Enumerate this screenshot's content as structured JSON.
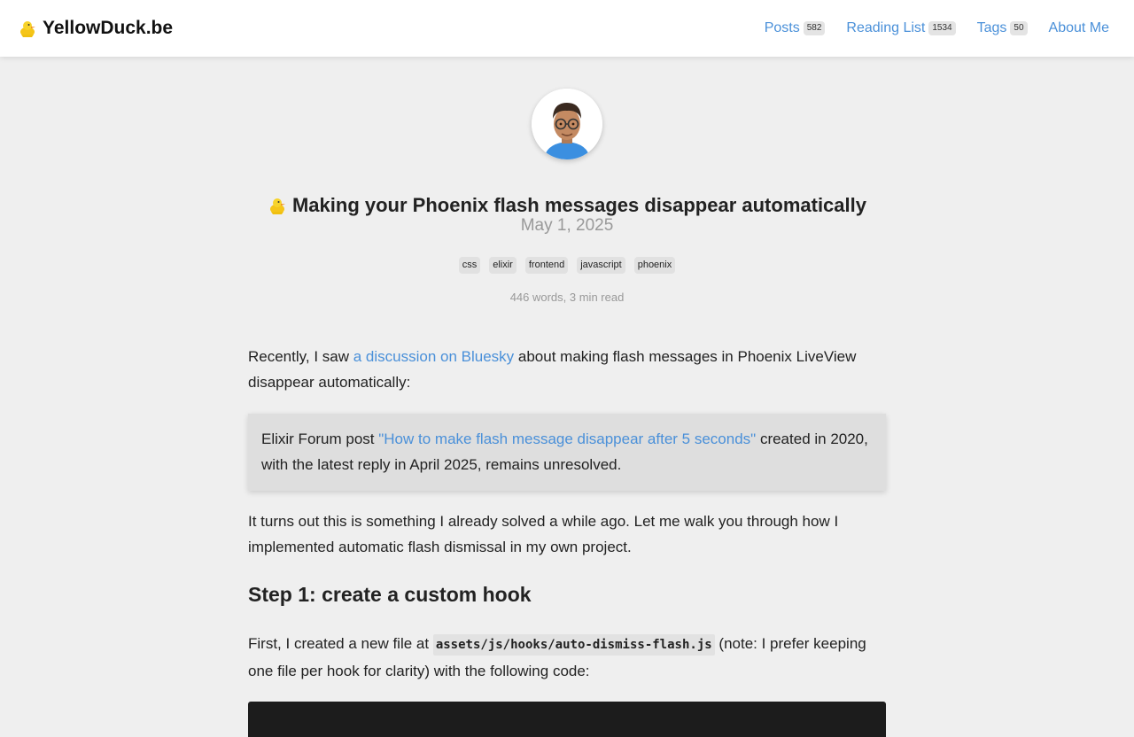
{
  "header": {
    "brand": "YellowDuck.be",
    "nav": [
      {
        "label": "Posts",
        "count": "582"
      },
      {
        "label": "Reading List",
        "count": "1534"
      },
      {
        "label": "Tags",
        "count": "50"
      },
      {
        "label": "About Me",
        "count": ""
      }
    ]
  },
  "post": {
    "title": "Making your Phoenix flash messages disappear automatically",
    "date": "May 1, 2025",
    "tags": [
      "css",
      "elixir",
      "frontend",
      "javascript",
      "phoenix"
    ],
    "meta": "446 words, 3 min read"
  },
  "content": {
    "p1_before": "Recently, I saw ",
    "p1_link": "a discussion on Bluesky",
    "p1_after": " about making flash messages in Phoenix LiveView disappear automatically:",
    "quote_before": "Elixir Forum post ",
    "quote_link": "\"How to make flash message disappear after 5 seconds\"",
    "quote_after": " created in 2020, with the latest reply in April 2025, remains unresolved.",
    "p2": "It turns out this is something I already solved a while ago. Let me walk you through how I implemented automatic flash dismissal in my own project.",
    "h2": "Step 1: create a custom hook",
    "p3_before": "First, I created a new file at ",
    "p3_code": "assets/js/hooks/auto-dismiss-flash.js",
    "p3_after": " (note: I prefer keeping one file per hook for clarity) with the following code:"
  },
  "colors": {
    "link": "#4a90d9",
    "background": "#efefef",
    "codeblock": "#1c1c1c"
  },
  "icons": {
    "brand": "duck-icon",
    "avatar": "avatar-memoji"
  }
}
